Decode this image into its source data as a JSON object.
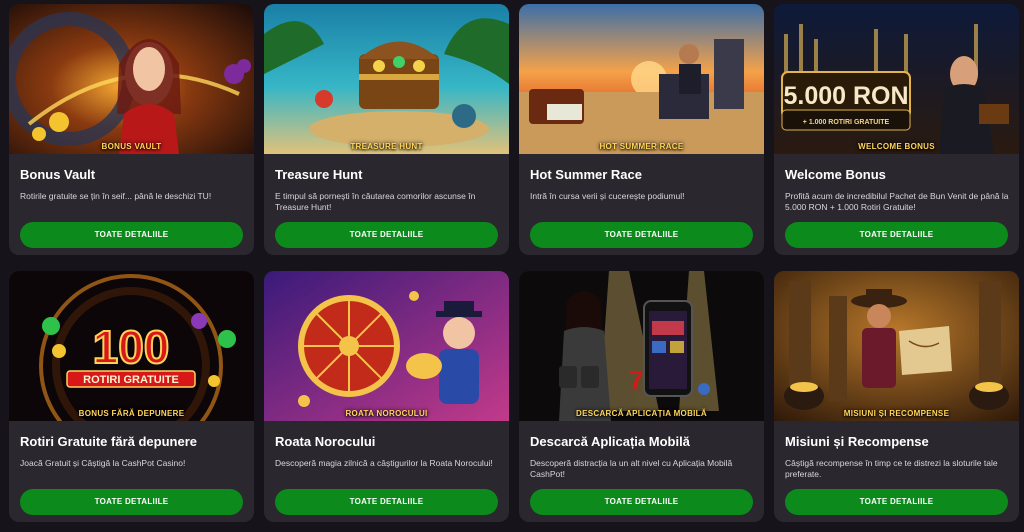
{
  "cards": [
    {
      "tag": "BONUS VAULT",
      "title": "Bonus Vault",
      "description": "Rotirile gratuite se țin în seif... până le deschizi TU!",
      "button": "TOATE DETALIILE"
    },
    {
      "tag": "TREASURE HUNT",
      "title": "Treasure Hunt",
      "description": "E timpul să pornești în căutarea comorilor ascunse în Treasure Hunt!",
      "button": "TOATE DETALIILE"
    },
    {
      "tag": "HOT SUMMER RACE",
      "title": "Hot Summer Race",
      "description": "Intră în cursa verii și cucerește podiumul!",
      "button": "TOATE DETALIILE"
    },
    {
      "tag": "WELCOME BONUS",
      "title": "Welcome Bonus",
      "description": "Profită acum de incredibilul Pachet de Bun Venit de până la 5.000 RON + 1.000 Rotiri Gratuite!",
      "button": "TOATE DETALIILE",
      "image_amount": "5.000 RON",
      "image_sub": "+ 1.000 ROTIRI GRATUITE"
    },
    {
      "tag": "BONUS FĂRĂ DEPUNERE",
      "title": "Rotiri Gratuite fără depunere",
      "description": "Joacă Gratuit și Câștigă la CashPot Casino!",
      "button": "TOATE DETALIILE",
      "image_big": "100",
      "image_sub": "ROTIRI GRATUITE"
    },
    {
      "tag": "ROATA NOROCULUI",
      "title": "Roata Norocului",
      "description": "Descoperă magia zilnică a câștigurilor la Roata Norocului!",
      "button": "TOATE DETALIILE"
    },
    {
      "tag": "DESCARCĂ APLICAȚIA MOBILĂ",
      "title": "Descarcă Aplicația Mobilă",
      "description": "Descoperă distracția la un alt nivel cu Aplicația Mobilă CashPot!",
      "button": "TOATE DETALIILE"
    },
    {
      "tag": "MISIUNI ȘI RECOMPENSE",
      "title": "Misiuni și Recompense",
      "description": "Câștigă recompense în timp ce te distrezi la sloturile tale preferate.",
      "button": "TOATE DETALIILE"
    }
  ],
  "colors": {
    "page_bg": "#16141a",
    "card_bg": "#2a272e",
    "button_bg": "#0c8a1c",
    "tag_text": "#ffd65a"
  }
}
